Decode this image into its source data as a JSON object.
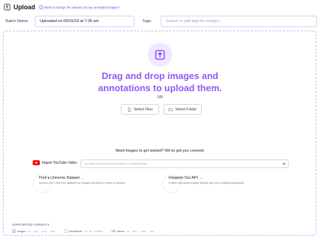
{
  "header": {
    "title": "Upload",
    "help_link": "Want to change the classes on your annotated images?"
  },
  "form": {
    "batch_label": "Batch Name:",
    "batch_value": "Uploaded on 09/15/23 at 7:36 am",
    "tags_label": "Tags:",
    "tags_placeholder": "Search or add tags for images..."
  },
  "dropzone": {
    "title_line1": "Drag and drop images and",
    "title_line2": "annotations to upload them.",
    "or_text": "OR",
    "select_files_label": "Select Files",
    "select_folder_label": "Select Folder"
  },
  "getting_started": {
    "heading": "Need images to get started? We've got you covered.",
    "youtube_label": "Import YouTube Video",
    "youtube_placeholder": "e.g. https://www.youtube.com/watch?v=xOxs0wAbHsq2",
    "universe_title": "Find a Universe Dataset",
    "universe_desc": "Access over 100k free datasets for images and build a model in minutes.",
    "api_title": "Integrate Our API",
    "api_desc": "Collect real-world images directly from your existing application."
  },
  "formats": {
    "title": "SUPPORTED FORMATS",
    "items": [
      {
        "label": "Images",
        "ext": "in .jpg, .png, .bmp"
      },
      {
        "label": "Annotations",
        "ext": "in 26 formats"
      },
      {
        "label": "Videos",
        "ext": "in .mov, .mp4, .avi"
      }
    ]
  },
  "colors": {
    "accent": "#8b5cf6",
    "youtube": "#ff0000"
  }
}
